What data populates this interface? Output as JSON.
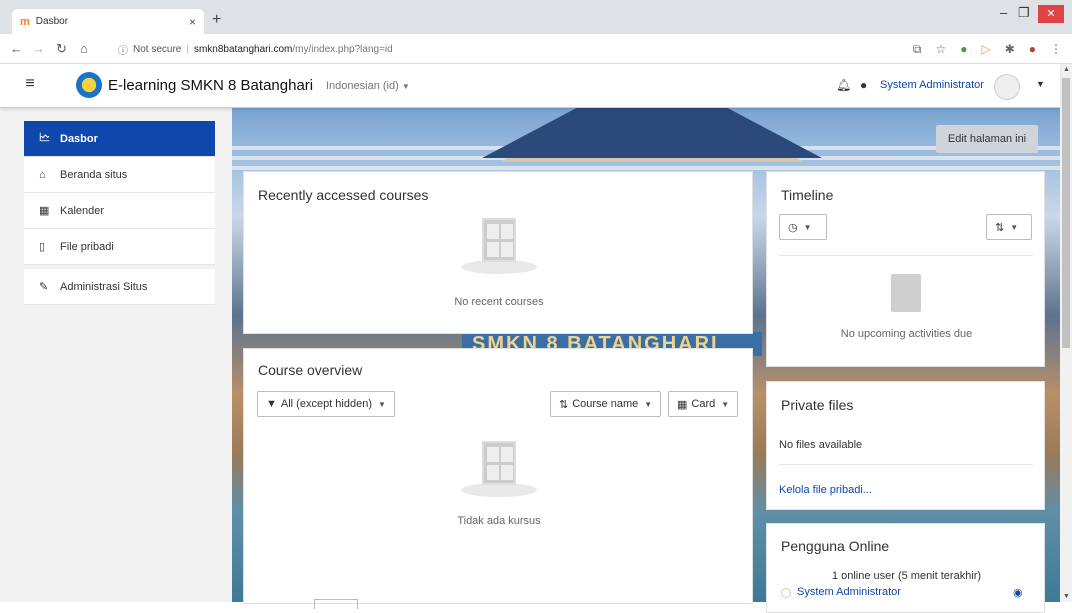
{
  "browser": {
    "tab_title": "Dasbor",
    "tab_favicon": "m",
    "tab_close": "×",
    "new_tab": "+",
    "url_security": "Not secure",
    "url_host": "smkn8batanghari.com",
    "url_path": "/my/index.php?lang=id",
    "win_min": "–",
    "win_max": "❐",
    "win_close": "✕"
  },
  "navbar": {
    "site_name": "E-learning SMKN 8 Batanghari",
    "language": "Indonesian ‎(id)‎",
    "user_name": "System Administrator"
  },
  "drawer": {
    "items": [
      {
        "label": "Dasbor",
        "icon": "dashboard-icon",
        "glyph": "🗠",
        "active": true
      },
      {
        "label": "Beranda situs",
        "icon": "home-icon",
        "glyph": "⌂"
      },
      {
        "label": "Kalender",
        "icon": "calendar-icon",
        "glyph": "▦"
      },
      {
        "label": "File pribadi",
        "icon": "file-icon",
        "glyph": "▯"
      },
      {
        "label": "Administrasi Situs",
        "icon": "wrench-icon",
        "glyph": "✎"
      }
    ]
  },
  "edit_page_label": "Edit halaman ini",
  "hero_sign": "SMKN 8 BATANGHARI",
  "recent": {
    "title": "Recently accessed courses",
    "empty": "No recent courses"
  },
  "overview": {
    "title": "Course overview",
    "filter_label": "All (except hidden)",
    "sort_label": "Course name",
    "view_label": "Card",
    "empty": "Tidak ada kursus"
  },
  "timeline": {
    "title": "Timeline",
    "empty": "No upcoming activities due"
  },
  "private_files": {
    "title": "Private files",
    "empty": "No files available",
    "manage_link": "Kelola file pribadi..."
  },
  "online_users": {
    "title": "Pengguna Online",
    "summary": "1 online user (5 menit terakhir)",
    "user": "System Administrator"
  },
  "colors": {
    "brand": "#0f47ad",
    "moodle_orange": "#f98012"
  }
}
